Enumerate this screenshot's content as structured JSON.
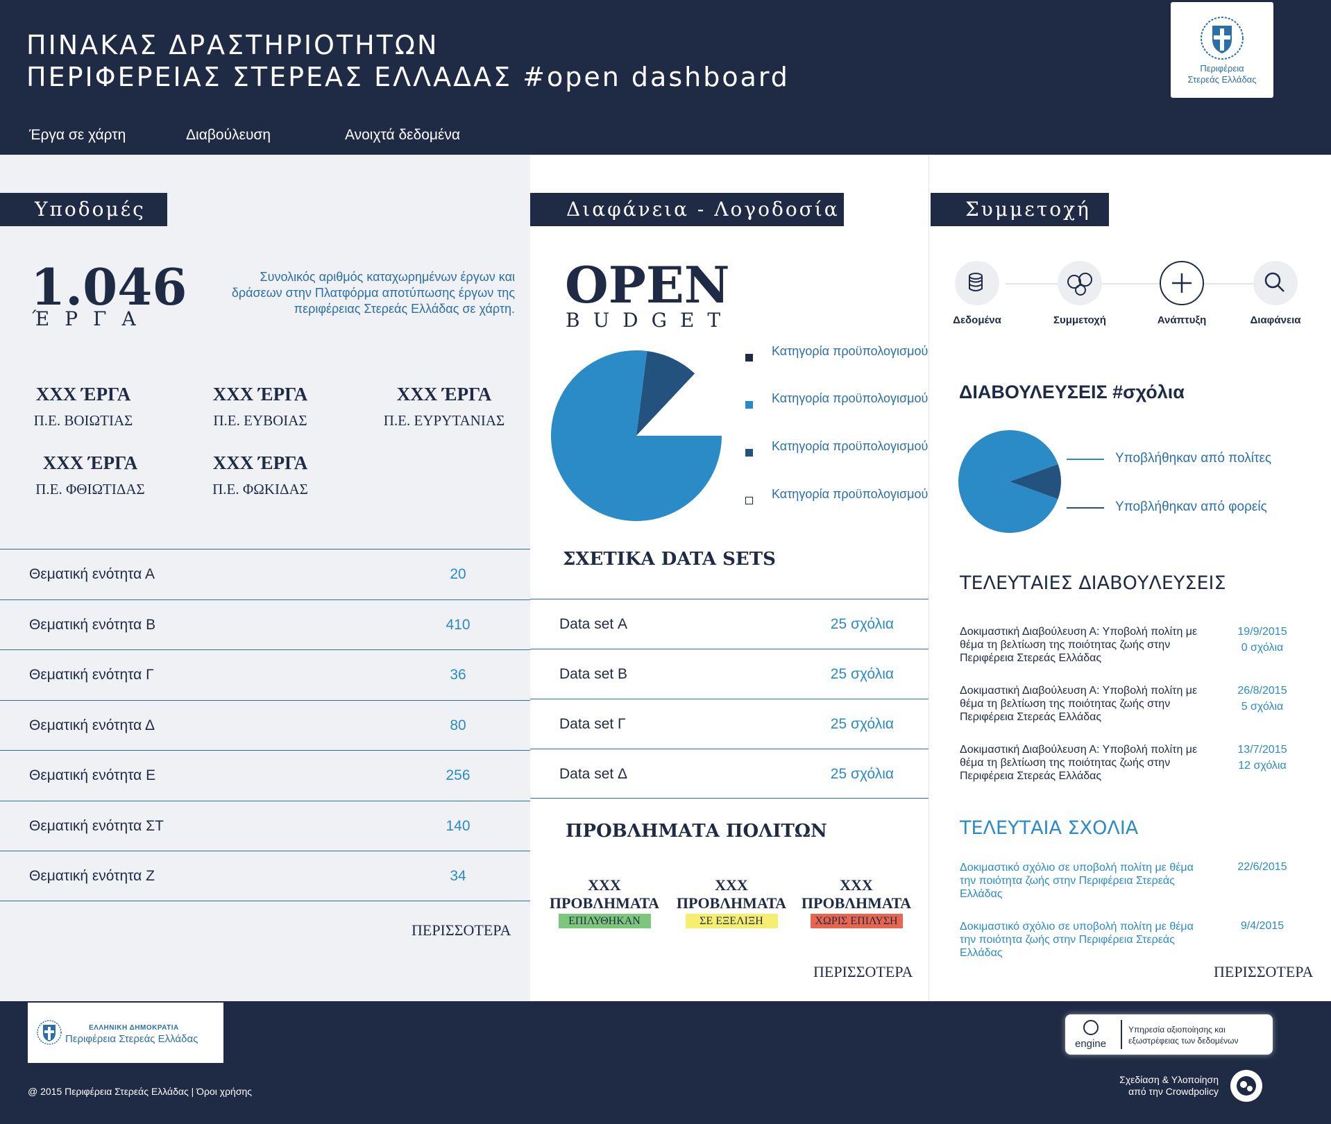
{
  "header": {
    "title_line1": "ΠΙΝΑΚΑΣ ΔΡΑΣΤΗΡΙΟΤΗΤΩΝ",
    "title_line2": "ΠΕΡΙΦΕΡΕΙΑΣ ΣΤΕΡΕΑΣ ΕΛΛΑΔΑΣ #open dashboard",
    "logo_text_line1": "Περιφέρεια",
    "logo_text_line2": "Στερεάς Ελλάδας",
    "logo_icon": "coat-of-arms-icon"
  },
  "nav": [
    "Έργα σε χάρτη",
    "Διαβούλευση",
    "Ανοιχτά δεδομένα"
  ],
  "colors": {
    "navy": "#1f2b45",
    "blue": "#2a8bc6",
    "dark_blue_slice": "#24527f",
    "green_badge": "#7dc77d",
    "yellow_badge": "#f5ee6e",
    "red_badge": "#e8664f"
  },
  "infra": {
    "section_title": "Υποδομές",
    "total_number": "1.046",
    "total_label": "ΈΡΓΑ",
    "description": "Συνολικός αριθμός καταχωρημένων έργων και δράσεων στην Πλατφόρμα αποτύπωσης έργων της περιφέρειας Στερεάς Ελλάδας σε χάρτη.",
    "regions": [
      {
        "count": "XXX ΈΡΓΑ",
        "name": "Π.Ε. ΒΟΙΩΤΙΑΣ"
      },
      {
        "count": "XXX ΈΡΓΑ",
        "name": "Π.Ε. ΕΥΒΟΙΑΣ"
      },
      {
        "count": "XXX ΈΡΓΑ",
        "name": "Π.Ε. ΕΥΡΥΤΑΝΙΑΣ"
      },
      {
        "count": "XXX ΈΡΓΑ",
        "name": "Π.Ε. ΦΘΙΩΤΙΔΑΣ"
      },
      {
        "count": "XXX ΈΡΓΑ",
        "name": "Π.Ε. ΦΩΚΙΔΑΣ"
      }
    ],
    "themes": [
      {
        "label": "Θεματική ενότητα Α",
        "value": "20"
      },
      {
        "label": "Θεματική ενότητα Β",
        "value": "410"
      },
      {
        "label": "Θεματική ενότητα Γ",
        "value": "36"
      },
      {
        "label": "Θεματική ενότητα Δ",
        "value": "80"
      },
      {
        "label": "Θεματική ενότητα Ε",
        "value": "256"
      },
      {
        "label": "Θεματική ενότητα ΣΤ",
        "value": "140"
      },
      {
        "label": "Θεματική ενότητα Ζ",
        "value": "34"
      }
    ],
    "more": "ΠΕΡΙΣΣΟΤΕΡΑ"
  },
  "transparency": {
    "section_title": "Διαφάνεια - Λογοδοσία",
    "open": "OPEN",
    "budget": "BUDGET",
    "legend": [
      "Κατηγορία προϋπολογισμού",
      "Κατηγορία προϋπολογισμού",
      "Κατηγορία προϋπολογισμού",
      "Κατηγορία προϋπολογισμού"
    ],
    "datasets_title": "ΣΧΕΤΙΚΑ DATA SETS",
    "datasets": [
      {
        "label": "Data set Α",
        "comments": "25 σχόλια"
      },
      {
        "label": "Data set Β",
        "comments": "25 σχόλια"
      },
      {
        "label": "Data set Γ",
        "comments": "25 σχόλια"
      },
      {
        "label": "Data set Δ",
        "comments": "25 σχόλια"
      }
    ],
    "problems_title": "ΠΡΟΒΛΗΜΑΤΑ ΠΟΛΙΤΩΝ",
    "problems": [
      {
        "count": "XXX",
        "label": "ΠΡΟΒΛΗΜΑΤΑ",
        "status": "ΕΠΙΛΥΘΗΚΑΝ"
      },
      {
        "count": "XXX",
        "label": "ΠΡΟΒΛΗΜΑΤΑ",
        "status": "ΣΕ ΕΞΕΛΙΞΗ"
      },
      {
        "count": "XXX",
        "label": "ΠΡΟΒΛΗΜΑΤΑ",
        "status": "ΧΩΡΙΣ ΕΠΙΛΥΣΗ"
      }
    ],
    "more": "ΠΕΡΙΣΣΟΤΕΡΑ"
  },
  "participation": {
    "section_title": "Συμμετοχή",
    "steps": [
      {
        "label": "Δεδομένα",
        "icon": "database-icon"
      },
      {
        "label": "Συμμετοχή",
        "icon": "people-icon"
      },
      {
        "label": "Ανάπτυξη",
        "icon": "plus-icon"
      },
      {
        "label": "Διαφάνεια",
        "icon": "magnifier-icon"
      }
    ],
    "consultations_title": "ΔΙΑΒΟΥΛΕΥΣΕΙΣ #σχόλια",
    "pie_legend": [
      "Υποβλήθηκαν από πολίτες",
      "Υποβλήθηκαν από φορείς"
    ],
    "latest_title": "ΤΕΛΕΥΤΑΙΕΣ ΔΙΑΒΟΥΛΕΥΣΕΙΣ",
    "latest": [
      {
        "text": "Δοκιμαστική Διαβούλευση Α: Υποβολή πολίτη με θέμα τη βελτίωση της ποιότητας ζωής στην Περιφέρεια Στερεάς Ελλάδας",
        "date": "19/9/2015",
        "comments": "0 σχόλια"
      },
      {
        "text": "Δοκιμαστική Διαβούλευση Α: Υποβολή πολίτη με θέμα τη βελτίωση της ποιότητας ζωής στην Περιφέρεια Στερεάς Ελλάδας",
        "date": "26/8/2015",
        "comments": "5 σχόλια"
      },
      {
        "text": "Δοκιμαστική Διαβούλευση Α: Υποβολή πολίτη με θέμα τη βελτίωση της ποιότητας ζωής στην Περιφέρεια Στερεάς Ελλάδας",
        "date": "13/7/2015",
        "comments": "12 σχόλια"
      }
    ],
    "comments_title": "ΤΕΛΕΥΤΑΙΑ ΣΧΟΛΙΑ",
    "comments": [
      {
        "text": "Δοκιμαστικό σχόλιο σε υποβολή πολίτη με θέμα την ποιότητα ζωής στην Περιφέρεια Στερεάς Ελλάδας",
        "date": "22/6/2015"
      },
      {
        "text": "Δοκιμαστικό σχόλιο σε υποβολή πολίτη με θέμα την ποιότητα ζωής στην Περιφέρεια Στερεάς Ελλάδας",
        "date": "9/4/2015"
      }
    ],
    "more": "ΠΕΡΙΣΣΟΤΕΡΑ"
  },
  "footer": {
    "logo_line1": "ΕΛΛΗΝΙΚΗ ΔΗΜΟΚΡΑΤΙΑ",
    "logo_line2": "Περιφέρεια Στερεάς Ελλάδας",
    "copyright": "@ 2015 Περιφέρεια Στερεάς Ελλάδας  |  Όροι χρήσης",
    "engine_word": "engine",
    "engine_text": "Υπηρεσία αξιοποίησης και εξωστρέφειας των δεδομένων",
    "credit_line1": "Σχεδίαση & Υλοποίηση",
    "credit_line2": "από την Crowdpolicy"
  },
  "chart_data": [
    {
      "type": "pie",
      "title": "",
      "labels": [
        "Κατηγορία προϋπολογισμού",
        "Κατηγορία προϋπολογισμού",
        "Κατηγορία προϋπολογισμού",
        "Κατηγορία προϋπολογισμού"
      ],
      "values": [
        77,
        10,
        13,
        0
      ],
      "colors": [
        "#2a8bc6",
        "#24527f",
        "#ffffff",
        "#ffffff"
      ]
    },
    {
      "type": "pie",
      "title": "",
      "labels": [
        "Υποβλήθηκαν από πολίτες",
        "Υποβλήθηκαν από φορείς"
      ],
      "values": [
        89,
        11
      ],
      "colors": [
        "#2a8bc6",
        "#24527f"
      ]
    }
  ]
}
